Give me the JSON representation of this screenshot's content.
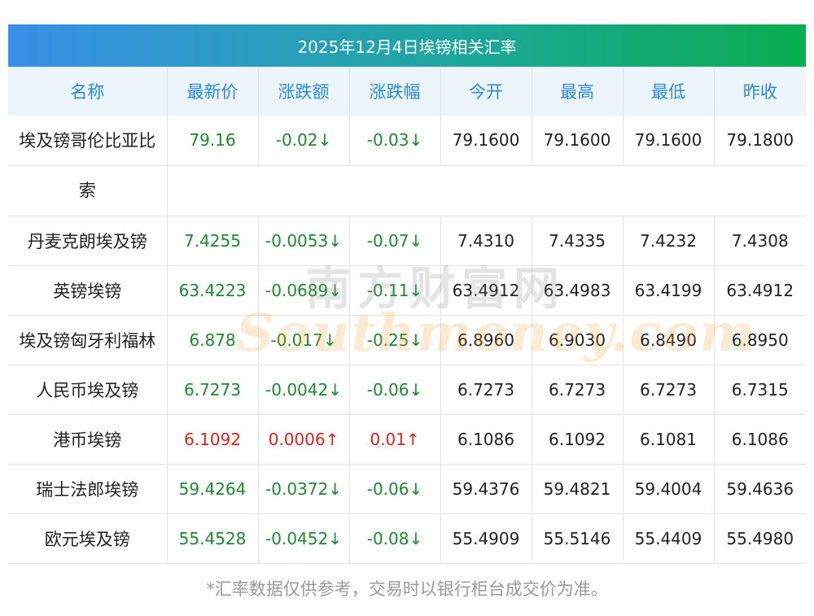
{
  "title": "2025年12月4日埃镑相关汇率",
  "columns": [
    "名称",
    "最新价",
    "涨跌额",
    "涨跌幅",
    "今开",
    "最高",
    "最低",
    "昨收"
  ],
  "rows": [
    {
      "name": "埃及镑哥伦比亚比",
      "name2": "索",
      "latest": "79.16",
      "change": "-0.02↓",
      "pct": "-0.03↓",
      "open": "79.1600",
      "high": "79.1600",
      "low": "79.1600",
      "prev": "79.1800",
      "trend": "down"
    },
    {
      "name": "丹麦克朗埃及镑",
      "latest": "7.4255",
      "change": "-0.0053↓",
      "pct": "-0.07↓",
      "open": "7.4310",
      "high": "7.4335",
      "low": "7.4232",
      "prev": "7.4308",
      "trend": "down"
    },
    {
      "name": "英镑埃镑",
      "latest": "63.4223",
      "change": "-0.0689↓",
      "pct": "-0.11↓",
      "open": "63.4912",
      "high": "63.4983",
      "low": "63.4199",
      "prev": "63.4912",
      "trend": "down"
    },
    {
      "name": "埃及镑匈牙利福林",
      "latest": "6.878",
      "change": "-0.017↓",
      "pct": "-0.25↓",
      "open": "6.8960",
      "high": "6.9030",
      "low": "6.8490",
      "prev": "6.8950",
      "trend": "down"
    },
    {
      "name": "人民币埃及镑",
      "latest": "6.7273",
      "change": "-0.0042↓",
      "pct": "-0.06↓",
      "open": "6.7273",
      "high": "6.7273",
      "low": "6.7273",
      "prev": "6.7315",
      "trend": "down"
    },
    {
      "name": "港币埃镑",
      "latest": "6.1092",
      "change": "0.0006↑",
      "pct": "0.01↑",
      "open": "6.1086",
      "high": "6.1092",
      "low": "6.1081",
      "prev": "6.1086",
      "trend": "up"
    },
    {
      "name": "瑞士法郎埃镑",
      "latest": "59.4264",
      "change": "-0.0372↓",
      "pct": "-0.06↓",
      "open": "59.4376",
      "high": "59.4821",
      "low": "59.4004",
      "prev": "59.4636",
      "trend": "down"
    },
    {
      "name": "欧元埃及镑",
      "latest": "55.4528",
      "change": "-0.0452↓",
      "pct": "-0.08↓",
      "open": "55.4909",
      "high": "55.5146",
      "low": "55.4409",
      "prev": "55.4980",
      "trend": "down"
    }
  ],
  "watermark": {
    "cn": "南方财富网",
    "en": "Southmoney.com"
  },
  "footnote": "*汇率数据仅供参考，交易时以银行柜台成交价为准。",
  "colors": {
    "up": "#e8201a",
    "down": "#1c8a2e",
    "header_text": "#2b8ad8"
  }
}
